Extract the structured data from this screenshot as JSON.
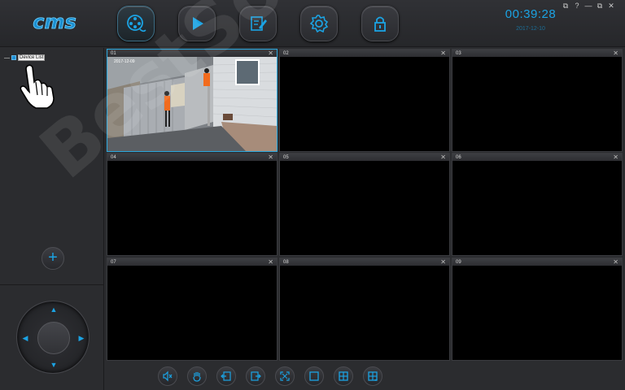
{
  "app": {
    "logo_text": "cms"
  },
  "toolbar_top": {
    "buttons": [
      {
        "name": "live-view",
        "icon": "film-reel-icon",
        "active": true
      },
      {
        "name": "playback",
        "icon": "play-icon",
        "active": false
      },
      {
        "name": "log",
        "icon": "edit-document-icon",
        "active": false
      },
      {
        "name": "settings",
        "icon": "gear-icon",
        "active": false
      },
      {
        "name": "lock",
        "icon": "lock-icon",
        "active": false
      }
    ],
    "clock": "00:39:28",
    "date": "2017-12-10"
  },
  "window_controls": [
    "⧉",
    "?",
    "—",
    "⧉",
    "✕"
  ],
  "device_tree": {
    "root_label": "Device List"
  },
  "grid": {
    "cells": [
      {
        "num": "01",
        "active": true,
        "has_video": true,
        "osd": "2017-12-09"
      },
      {
        "num": "02",
        "active": false,
        "has_video": false
      },
      {
        "num": "03",
        "active": false,
        "has_video": false
      },
      {
        "num": "04",
        "active": false,
        "has_video": false
      },
      {
        "num": "05",
        "active": false,
        "has_video": false
      },
      {
        "num": "06",
        "active": false,
        "has_video": false
      },
      {
        "num": "07",
        "active": false,
        "has_video": false
      },
      {
        "num": "08",
        "active": false,
        "has_video": false
      },
      {
        "num": "09",
        "active": false,
        "has_video": false
      }
    ]
  },
  "bottom_toolbar": [
    {
      "name": "mute",
      "icon": "speaker-mute-icon"
    },
    {
      "name": "ptz-hand",
      "icon": "hand-icon"
    },
    {
      "name": "prev-page",
      "icon": "page-back-icon"
    },
    {
      "name": "next-page",
      "icon": "page-forward-icon"
    },
    {
      "name": "fullscreen",
      "icon": "fullscreen-icon"
    },
    {
      "name": "layout-1",
      "icon": "single-view-icon"
    },
    {
      "name": "layout-4",
      "icon": "quad-view-icon"
    },
    {
      "name": "layout-custom",
      "icon": "custom-layout-icon"
    }
  ],
  "watermark": "BestSoft.club",
  "colors": {
    "accent": "#1ba3e3",
    "background": "#2b2c2f",
    "active_border": "#2aa8de"
  }
}
